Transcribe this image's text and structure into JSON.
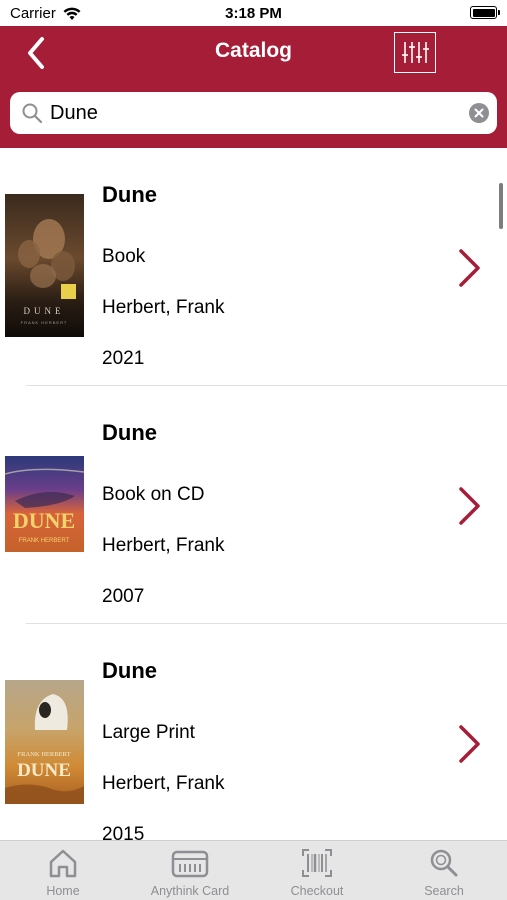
{
  "status_bar": {
    "carrier": "Carrier",
    "time": "3:18 PM"
  },
  "navbar": {
    "title": "Catalog",
    "back_icon": "chevron-left-icon",
    "filter_icon": "sliders-icon",
    "color": "#a51d36"
  },
  "search": {
    "value": "Dune",
    "placeholder": "",
    "clear_icon": "clear-icon"
  },
  "results": [
    {
      "title": "Dune",
      "format": "Book",
      "author": "Herbert, Frank",
      "year": "2021",
      "cover_text": "DUNE",
      "cover_subtext": "FRANK HERBERT"
    },
    {
      "title": "Dune",
      "format": "Book on CD",
      "author": "Herbert, Frank",
      "year": "2007",
      "cover_text": "DUNE",
      "cover_subtext": "FRANK HERBERT"
    },
    {
      "title": "Dune",
      "format": "Large Print",
      "author": "Herbert, Frank",
      "year": "2015",
      "cover_text": "DUNE",
      "cover_subtext": "FRANK HERBERT"
    }
  ],
  "tabbar": [
    {
      "label": "Home",
      "icon": "home-icon"
    },
    {
      "label": "Anythink Card",
      "icon": "card-icon"
    },
    {
      "label": "Checkout",
      "icon": "barcode-icon"
    },
    {
      "label": "Search",
      "icon": "search-icon"
    }
  ],
  "colors": {
    "accent": "#a51d36",
    "tab_inactive": "#8e8e93",
    "tab_bar_bg": "#e6e6e6"
  }
}
